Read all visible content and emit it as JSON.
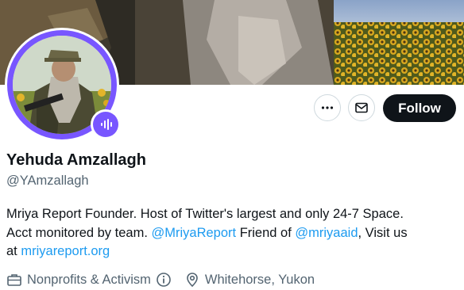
{
  "profile": {
    "display_name": "Yehuda Amzallagh",
    "handle": "@YAmzallagh"
  },
  "actions": {
    "more_icon": "more-horizontal-icon",
    "message_icon": "envelope-icon",
    "follow_label": "Follow"
  },
  "bio": {
    "line1": "Mriya Report Founder. Host of Twitter's largest and only 24-7 Space.",
    "line2_text": "Acct monitored by team. ",
    "line2_mention1": "@MriyaReport",
    "line2_mid": " Friend of ",
    "line2_mention2": "@mriyaaid",
    "line2_end": ", Visit us",
    "line3_text": "at ",
    "line3_link": "mriyareport.org"
  },
  "meta": {
    "category": "Nonprofits & Activism",
    "category_icon": "briefcase-icon",
    "info_icon": "info-icon",
    "location": "Whitehorse, Yukon",
    "location_icon": "location-pin-icon"
  },
  "badge": {
    "icon": "spaces-microphone-icon"
  },
  "colors": {
    "accent": "#1d9bf0",
    "spaces_purple": "#7856ff",
    "text_primary": "#0f1419",
    "text_secondary": "#536471",
    "follow_bg": "#0f1419"
  }
}
